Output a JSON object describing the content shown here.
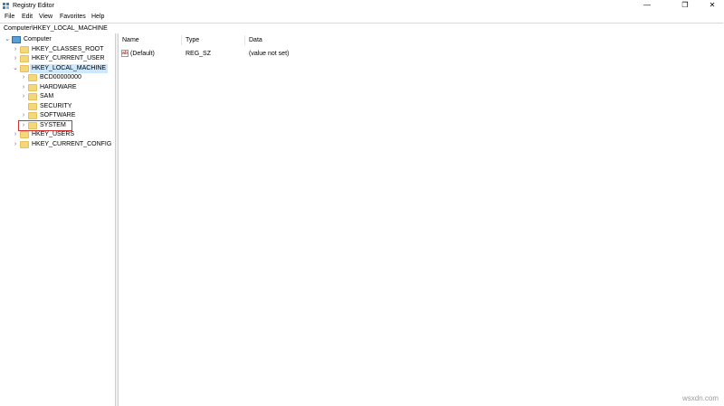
{
  "window": {
    "title": "Registry Editor",
    "minimize": "—",
    "maximize": "❐",
    "close": "✕"
  },
  "menu": [
    "File",
    "Edit",
    "View",
    "Favorites",
    "Help"
  ],
  "address": "Computer\\HKEY_LOCAL_MACHINE",
  "tree": {
    "root": "Computer",
    "hives": [
      "HKEY_CLASSES_ROOT",
      "HKEY_CURRENT_USER",
      "HKEY_LOCAL_MACHINE",
      "HKEY_USERS",
      "HKEY_CURRENT_CONFIG"
    ],
    "hklm_children": [
      "BCD00000000",
      "HARDWARE",
      "SAM",
      "SECURITY",
      "SOFTWARE",
      "SYSTEM"
    ]
  },
  "list": {
    "headers": [
      "Name",
      "Type",
      "Data"
    ],
    "rows": [
      {
        "name": "(Default)",
        "type": "REG_SZ",
        "data": "(value not set)"
      }
    ]
  },
  "watermark": "wsxdn.com",
  "colors": {
    "selection": "#cce8ff",
    "highlight_box": "#d32f2f",
    "folder": "#f5d77b"
  }
}
